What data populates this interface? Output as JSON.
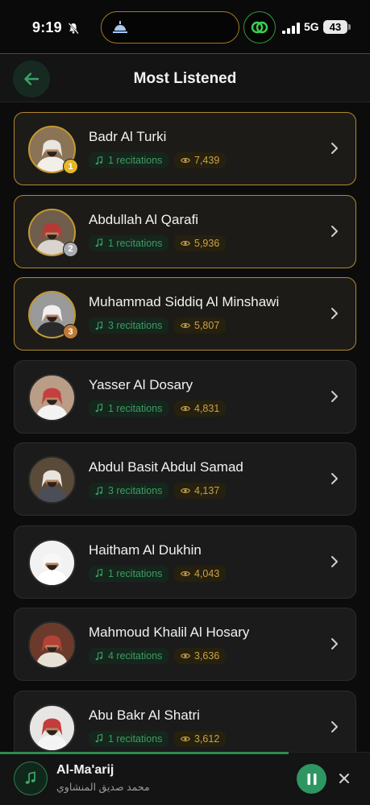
{
  "status_bar": {
    "time": "9:19",
    "network": "5G",
    "battery": "43",
    "colors": {
      "island_border": "#a07a1f",
      "link_badge_border": "#2e9a3a"
    }
  },
  "header": {
    "title": "Most Listened",
    "back_icon": "arrow-left-icon"
  },
  "reciters": [
    {
      "name": "Badr Al Turki",
      "recitations": "1 recitations",
      "views": "7,439",
      "rank": "1",
      "rank_color": "#e5b823",
      "avatar_bg": "#8b7456",
      "robe": "#f2efe9",
      "headwear": "#e9e6e0"
    },
    {
      "name": "Abdullah Al Qarafi",
      "recitations": "1 recitations",
      "views": "5,936",
      "rank": "2",
      "rank_color": "#a9acb1",
      "avatar_bg": "#6f5e4c",
      "robe": "#d9d4cd",
      "headwear": "#b53a36"
    },
    {
      "name": "Muhammad Siddiq Al Minshawi",
      "recitations": "3 recitations",
      "views": "5,807",
      "rank": "3",
      "rank_color": "#c07a35",
      "avatar_bg": "#9a9a9a",
      "robe": "#2a2a2a",
      "headwear": "#f0f0f0"
    },
    {
      "name": "Yasser Al Dosary",
      "recitations": "1 recitations",
      "views": "4,831",
      "rank": "",
      "rank_color": "",
      "avatar_bg": "#b99d86",
      "robe": "#f3f3f3",
      "headwear": "#c44040"
    },
    {
      "name": "Abdul Basit Abdul Samad",
      "recitations": "3 recitations",
      "views": "4,137",
      "rank": "",
      "rank_color": "",
      "avatar_bg": "#5a4a3a",
      "robe": "#4b4e56",
      "headwear": "#e8e4dc"
    },
    {
      "name": "Haitham Al Dukhin",
      "recitations": "1 recitations",
      "views": "4,043",
      "rank": "",
      "rank_color": "",
      "avatar_bg": "#f2f2f2",
      "robe": "#ffffff",
      "headwear": "#f7f7f7"
    },
    {
      "name": "Mahmoud Khalil Al Hosary",
      "recitations": "4 recitations",
      "views": "3,636",
      "rank": "",
      "rank_color": "",
      "avatar_bg": "#6b3a2a",
      "robe": "#e6e1d7",
      "headwear": "#b34236"
    },
    {
      "name": "Abu Bakr Al Shatri",
      "recitations": "1 recitations",
      "views": "3,612",
      "rank": "",
      "rank_color": "",
      "avatar_bg": "#e8e6e4",
      "robe": "#f4f4f4",
      "headwear": "#c43c3c"
    }
  ],
  "player": {
    "title": "Al-Ma'arij",
    "subtitle": "محمد صديق المنشاوي",
    "progress": 0.78,
    "icons": {
      "disc": "music-note-icon",
      "pause": "pause-icon",
      "close": "close-icon"
    },
    "accent": "#2e9660"
  }
}
